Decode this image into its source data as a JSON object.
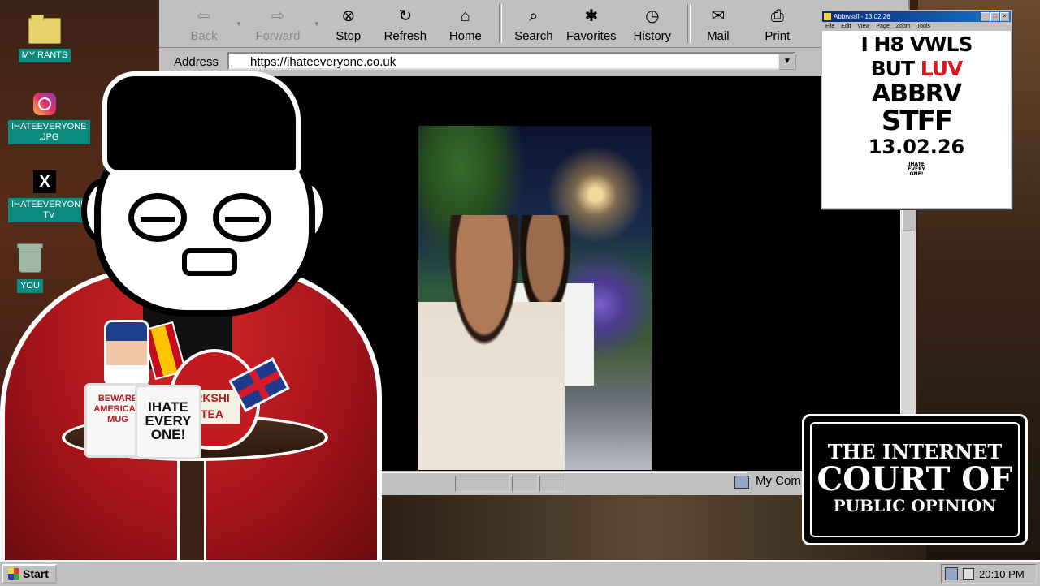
{
  "desktop": {
    "icons": [
      {
        "label": "MY RANTS",
        "icon": "folder-icon"
      },
      {
        "label": "IHATEEVERYONE\n.JPG",
        "icon": "instagram-icon"
      },
      {
        "label": "IHATEEVERYONE\nTV",
        "icon": "x-icon"
      },
      {
        "label": "YOU",
        "icon": "recycle-bin-icon"
      }
    ]
  },
  "browser": {
    "toolbar": {
      "back": "Back",
      "forward": "Forward",
      "stop": "Stop",
      "refresh": "Refresh",
      "home": "Home",
      "search": "Search",
      "favorites": "Favorites",
      "history": "History",
      "mail": "Mail",
      "print": "Print"
    },
    "address_label": "Address",
    "url": "https://ihateeveryone.co.uk",
    "status_zone": "My Com"
  },
  "props": {
    "mug1_text": "BEWARE\nAMERICAN\nMUG",
    "mug2_text": "IHATE\nEVERY\nONE!",
    "teapot_label": "RKSHI\nTEA"
  },
  "popup": {
    "title": "Abbrvstff - 13.02.26",
    "menu": [
      "File",
      "Edit",
      "View",
      "Page",
      "Zoom",
      "Tools"
    ],
    "poster_line1": "I H8 VWLS",
    "poster_line2a": "BUT ",
    "poster_line2b": "LUV",
    "poster_line3": "ABBRV",
    "poster_line4": "STFF",
    "poster_date": "13.02.26",
    "poster_logo": "IHATE\nEVERY\nONE!",
    "accent_color": "#e0141c"
  },
  "court_sign": {
    "line1": "THE INTERNET",
    "line2": "COURT OF",
    "line3": "PUBLIC OPINION"
  },
  "taskbar": {
    "start": "Start",
    "clock": "20:10 PM"
  }
}
